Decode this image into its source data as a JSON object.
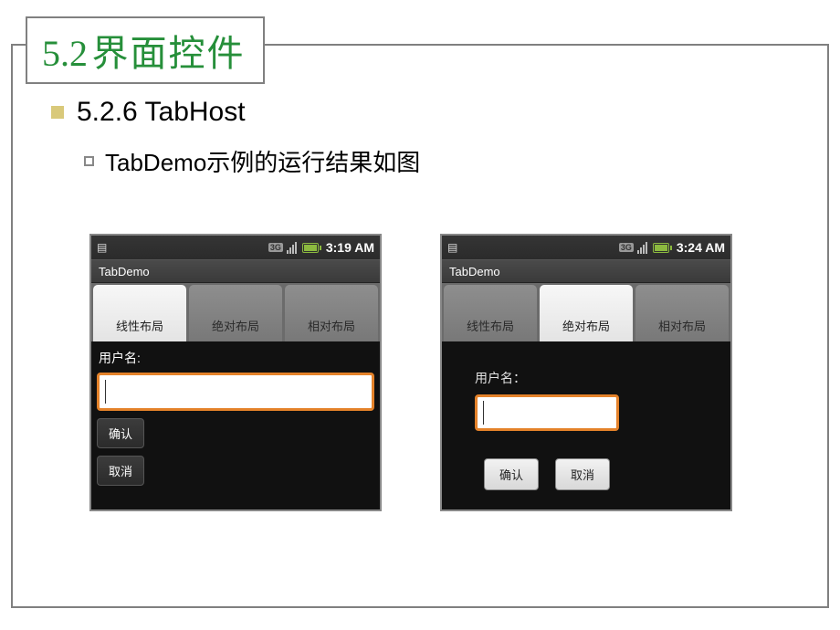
{
  "slide": {
    "title_num": "5.2",
    "title_cn": "界面控件",
    "h2": "5.2.6 TabHost",
    "h3": "TabDemo示例的运行结果如图"
  },
  "phones": [
    {
      "time": "3:19 AM",
      "app_title": "TabDemo",
      "active_tab": 0,
      "tabs": [
        "线性布局",
        "绝对布局",
        "相对布局"
      ],
      "label": "用户名:",
      "input_value": "",
      "buttons": [
        "确认",
        "取消"
      ]
    },
    {
      "time": "3:24 AM",
      "app_title": "TabDemo",
      "active_tab": 1,
      "tabs": [
        "线性布局",
        "绝对布局",
        "相对布局"
      ],
      "label": "用户名：",
      "input_value": "",
      "buttons": [
        "确认",
        "取消"
      ]
    }
  ]
}
